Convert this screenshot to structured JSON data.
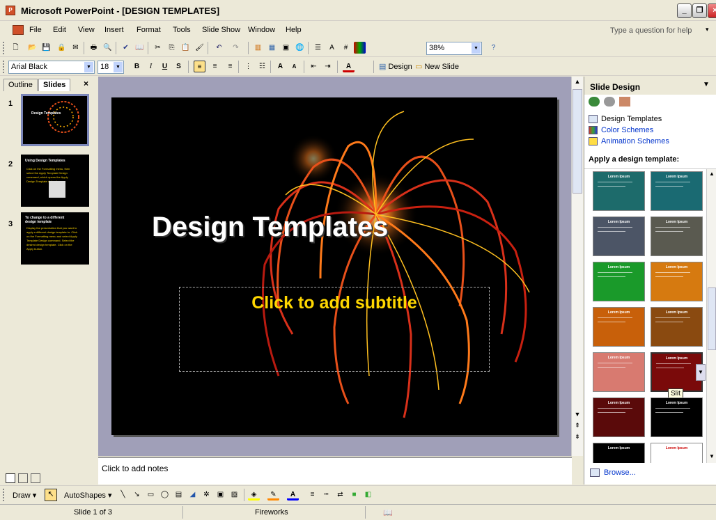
{
  "window": {
    "title": "Microsoft PowerPoint - [DESIGN TEMPLATES]"
  },
  "menu": [
    "File",
    "Edit",
    "View",
    "Insert",
    "Format",
    "Tools",
    "Slide Show",
    "Window",
    "Help"
  ],
  "help_box": {
    "placeholder": "Type a question for help"
  },
  "standard_toolbar": {
    "zoom": "38%"
  },
  "formatting_toolbar": {
    "font": "Arial Black",
    "size": "18",
    "design_label": "Design",
    "new_slide_label": "New Slide"
  },
  "tabs": {
    "outline": "Outline",
    "slides": "Slides"
  },
  "thumbnails": [
    {
      "num": "1",
      "title": "Design Templates"
    },
    {
      "num": "2",
      "title": "Using Design Templates",
      "body": "Click on the Formatting menu, then select the Apply Template Design command, which opens the Apply Design Template dialog box."
    },
    {
      "num": "3",
      "title": "To change to a different design template",
      "body": "Display the presentation that you want to apply a different design template to. Click on the Formatting menu and select Apply Template Design command. Select the desired design template. Click on the Apply button."
    }
  ],
  "slide": {
    "title": "Design Templates",
    "subtitle": "Click to add subtitle"
  },
  "notes": {
    "placeholder": "Click to add notes"
  },
  "task_pane": {
    "title": "Slide Design",
    "links": [
      "Design Templates",
      "Color Schemes",
      "Animation Schemes"
    ],
    "apply_label": "Apply a design template:",
    "template_label": "Lorem Ipsum",
    "tooltip": "Slit",
    "browse": "Browse..."
  },
  "draw_toolbar": {
    "draw": "Draw",
    "autoshapes": "AutoShapes"
  },
  "status": {
    "slide": "Slide 1 of 3",
    "design": "Fireworks"
  },
  "colors": {
    "accent": "#ffd700",
    "panel_bg": "#a09fb8",
    "link": "#0033cc"
  }
}
